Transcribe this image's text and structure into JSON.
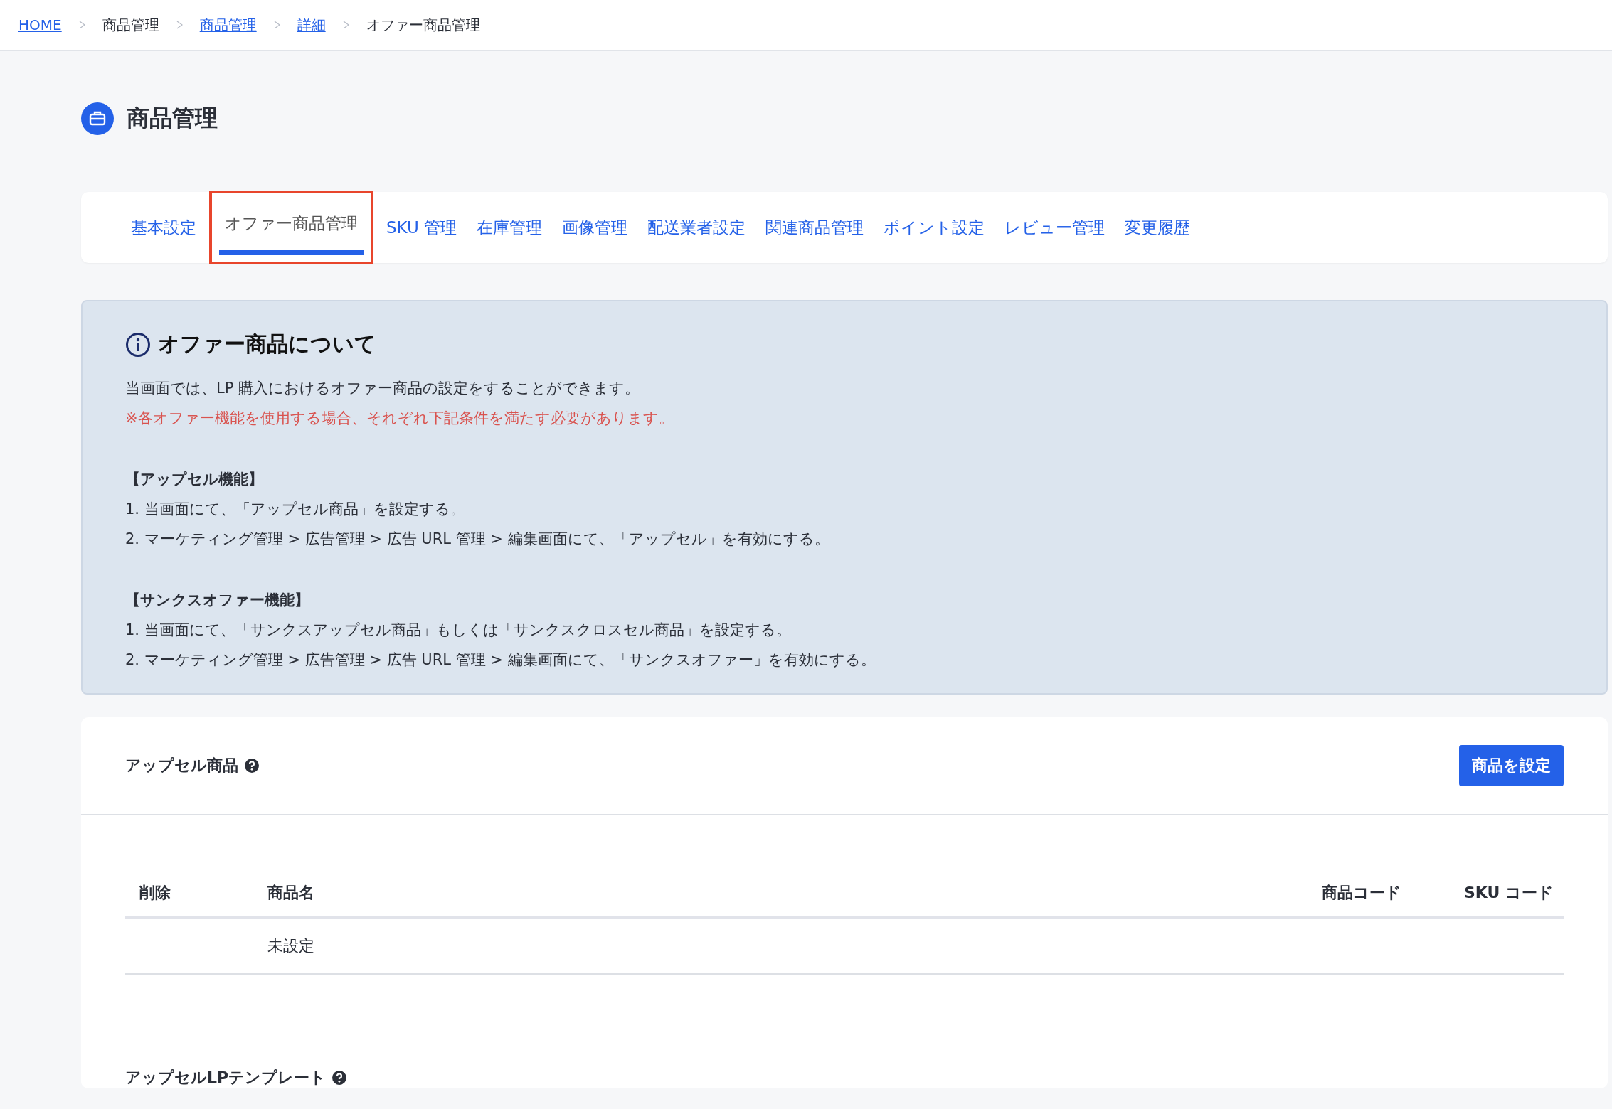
{
  "breadcrumb": [
    {
      "label": "HOME",
      "link": true
    },
    {
      "label": "商品管理",
      "link": false
    },
    {
      "label": "商品管理",
      "link": true
    },
    {
      "label": "詳細",
      "link": true
    },
    {
      "label": "オファー商品管理",
      "link": false
    }
  ],
  "page_title": "商品管理",
  "tabs": [
    {
      "label": "基本設定",
      "selected": false,
      "highlighted": false
    },
    {
      "label": "オファー商品管理",
      "selected": true,
      "highlighted": true
    },
    {
      "label": "SKU 管理",
      "selected": false,
      "highlighted": false
    },
    {
      "label": "在庫管理",
      "selected": false,
      "highlighted": false
    },
    {
      "label": "画像管理",
      "selected": false,
      "highlighted": false
    },
    {
      "label": "配送業者設定",
      "selected": false,
      "highlighted": false
    },
    {
      "label": "関連商品管理",
      "selected": false,
      "highlighted": false
    },
    {
      "label": "ポイント設定",
      "selected": false,
      "highlighted": false
    },
    {
      "label": "レビュー管理",
      "selected": false,
      "highlighted": false
    },
    {
      "label": "変更履歴",
      "selected": false,
      "highlighted": false
    }
  ],
  "info": {
    "title": "オファー商品について",
    "lines": [
      {
        "kind": "text",
        "text": "当画面では、LP 購入におけるオファー商品の設定をすることができます。"
      },
      {
        "kind": "warning",
        "text": "※各オファー機能を使用する場合、それぞれ下記条件を満たす必要があります。"
      },
      {
        "kind": "spacer"
      },
      {
        "kind": "heading",
        "text": "【アップセル機能】"
      },
      {
        "kind": "text",
        "text": "1. 当画面にて、「アップセル商品」を設定する。"
      },
      {
        "kind": "text",
        "text": "2. マーケティング管理 > 広告管理 > 広告 URL 管理 > 編集画面にて、「アップセル」を有効にする。"
      },
      {
        "kind": "spacer"
      },
      {
        "kind": "heading",
        "text": "【サンクスオファー機能】"
      },
      {
        "kind": "text",
        "text": "1. 当画面にて、「サンクスアップセル商品」もしくは「サンクスクロスセル商品」を設定する。"
      },
      {
        "kind": "text",
        "text": "2. マーケティング管理 > 広告管理 > 広告 URL 管理 > 編集画面にて、「サンクスオファー」を有効にする。"
      }
    ]
  },
  "upsell_section": {
    "title": "アップセル商品",
    "button": "商品を設定",
    "table": {
      "columns": [
        "削除",
        "商品名",
        "商品コード",
        "SKU コード"
      ],
      "rows": [
        [
          "",
          "未設定",
          "",
          ""
        ]
      ]
    }
  },
  "template_section": {
    "title": "アップセルLPテンプレート"
  }
}
